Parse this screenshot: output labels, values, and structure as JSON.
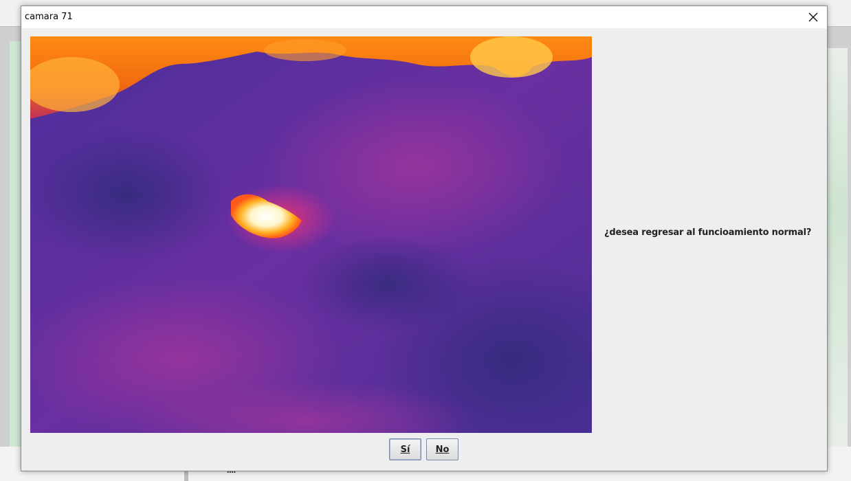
{
  "window": {
    "title": "camara 71",
    "close_icon": "close-icon"
  },
  "dialog": {
    "message": "¿desea regresar al funcioamiento normal?",
    "image": "thermal-camera-image",
    "buttons": {
      "yes": "Sí",
      "no": "No"
    }
  },
  "background": {
    "partial_text": "...."
  },
  "colors": {
    "dialog_bg": "#eeeeee",
    "thermal_cold": "#3b2a8c",
    "thermal_mid": "#8d2b9a",
    "thermal_hot": "#ff9a1a",
    "thermal_hottest": "#fffbe6"
  }
}
